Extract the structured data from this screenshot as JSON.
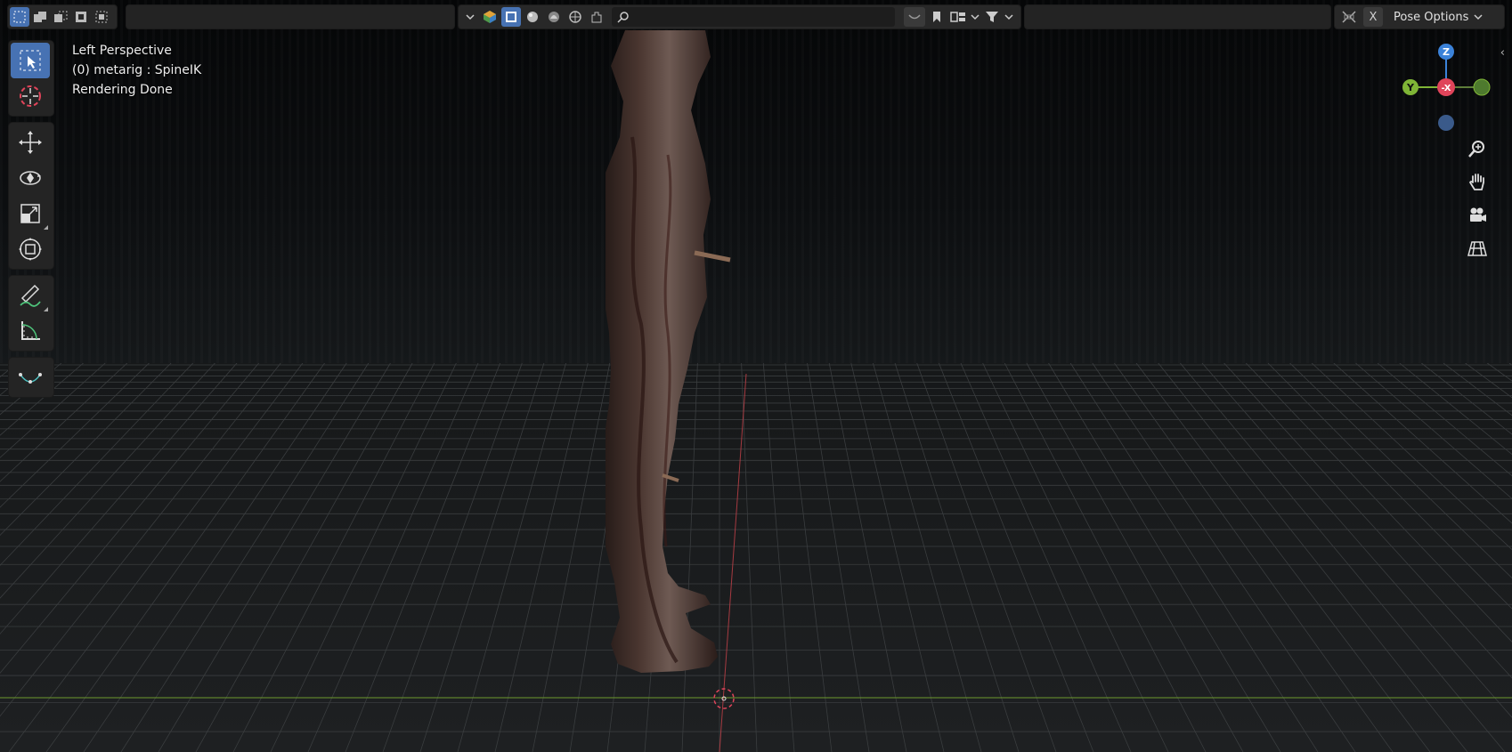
{
  "header": {
    "select_modes": [
      "select-box-new-icon",
      "select-box-extend-icon",
      "select-box-subtract-icon",
      "select-box-invert-icon",
      "select-box-intersect-icon"
    ],
    "search": {
      "value": "",
      "placeholder": ""
    },
    "close_label": "X",
    "pose_options_label": "Pose Options"
  },
  "overlay": {
    "view_name": "Left Perspective",
    "object_info": "(0) metarig : SpineIK",
    "render_status": "Rendering Done"
  },
  "gizmo": {
    "z_label": "Z",
    "y_label": "Y",
    "x_label": "-X"
  },
  "colors": {
    "accent": "#4772b3",
    "axis_x": "#e0445a",
    "axis_y": "#7fb536",
    "axis_z": "#3b82d9",
    "axis_neg": "#3a5a8a",
    "grid": "#3a3d3f",
    "ground_line": "#6d9a2e"
  }
}
